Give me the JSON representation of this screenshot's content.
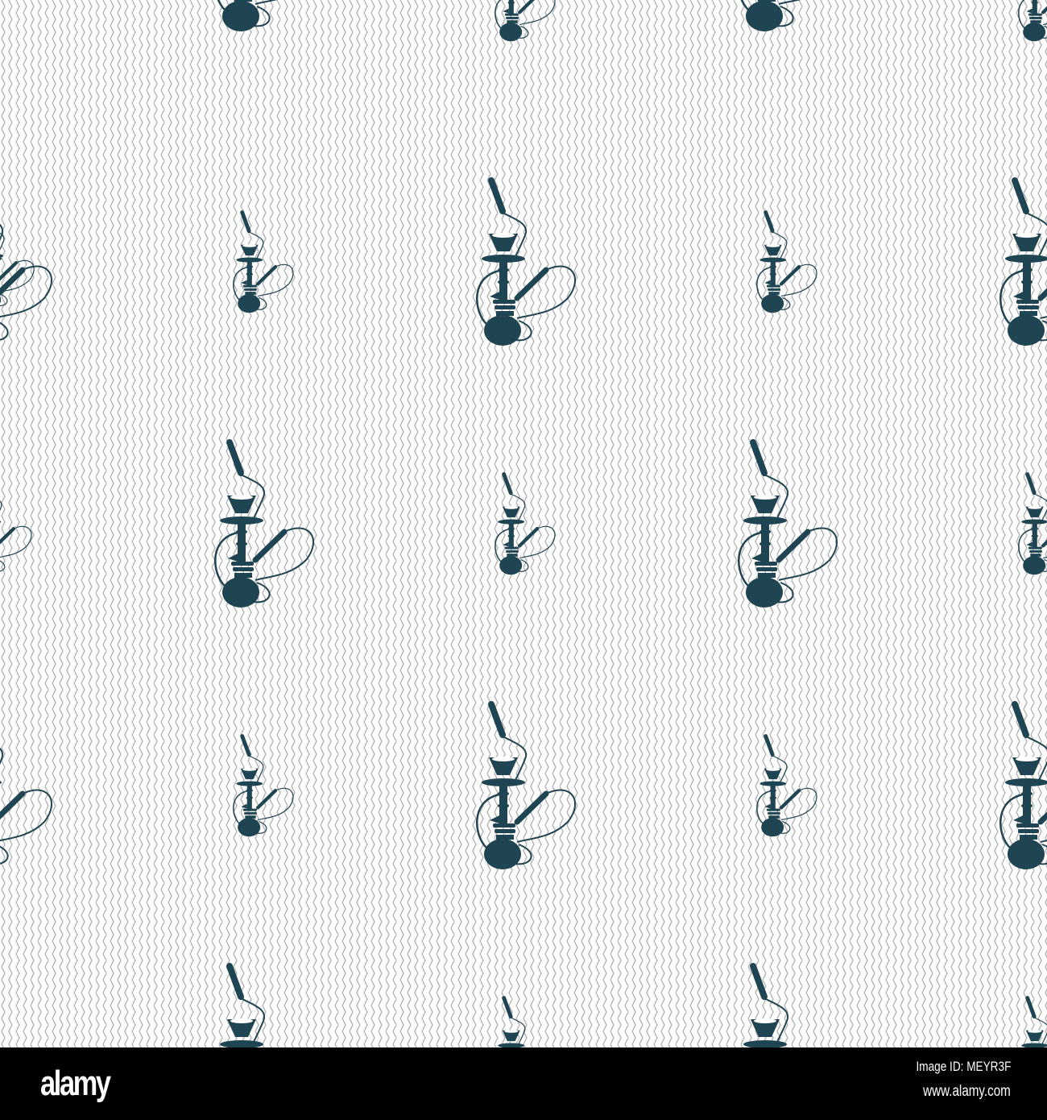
{
  "pattern": {
    "motif": "hookah-icon",
    "icon_color": "#1f4452",
    "line_color": "#b4b4b4",
    "background_color": "#ffffff"
  },
  "watermark": {
    "logo": "alamy",
    "image_id": "Image ID: MEYR3F",
    "url": "www.alamy.com"
  }
}
